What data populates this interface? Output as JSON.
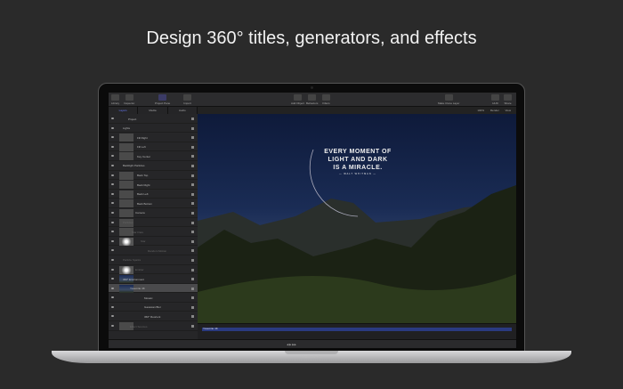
{
  "headline": "Design 360° titles, generators, and effects",
  "toolbar": {
    "library": "Library",
    "inspector": "Inspector",
    "project_pane": "Project Pane",
    "import": "Import",
    "add_object": "Add Object",
    "behaviors": "Behaviors",
    "filters": "Filters",
    "make_clone": "Make Clone Layer",
    "hud": "HUD",
    "share": "Share"
  },
  "tabs": [
    {
      "label": "Layers",
      "active": true
    },
    {
      "label": "Media"
    },
    {
      "label": "Audio"
    }
  ],
  "view_options": {
    "zoom": "100%",
    "render": "Render",
    "view": "View"
  },
  "layers": [
    {
      "name": "Project",
      "indent": 22,
      "thumb": false
    },
    {
      "name": "Lights",
      "indent": 16,
      "thumb": false
    },
    {
      "name": "Fill Right",
      "indent": 32,
      "thumb": true
    },
    {
      "name": "Fill Left",
      "indent": 32,
      "thumb": true
    },
    {
      "name": "Key Center",
      "indent": 32,
      "thumb": true
    },
    {
      "name": "Backlight Particles",
      "indent": 16,
      "thumb": false
    },
    {
      "name": "Back Top",
      "indent": 32,
      "thumb": true
    },
    {
      "name": "Back Right",
      "indent": 32,
      "thumb": true
    },
    {
      "name": "Back Left",
      "indent": 32,
      "thumb": true
    },
    {
      "name": "Back Bottom",
      "indent": 32,
      "thumb": true
    },
    {
      "name": "Camera",
      "indent": 30,
      "thumb": true
    },
    {
      "name": "Particles",
      "indent": 16,
      "thumb": true,
      "dim": true
    },
    {
      "name": "Star Flare",
      "indent": 26,
      "thumb": true,
      "dim": true
    },
    {
      "name": "Star",
      "indent": 36,
      "thumb": "glow",
      "dim": true
    },
    {
      "name": "Random Motion",
      "indent": 44,
      "thumb": false,
      "dim": true
    },
    {
      "name": "Particle Sparks",
      "indent": 16,
      "thumb": false,
      "dim": true
    },
    {
      "name": "Emitter",
      "indent": 30,
      "thumb": "glow",
      "dim": true
    },
    {
      "name": "360° Environment",
      "indent": 16,
      "thumb": "pic"
    },
    {
      "name": "Yosemite 4K",
      "indent": 24,
      "thumb": "pic",
      "selected": true
    },
    {
      "name": "Mosaic",
      "indent": 40,
      "thumb": false
    },
    {
      "name": "Gaussian Blur",
      "indent": 40,
      "thumb": false
    },
    {
      "name": "360° Reorient",
      "indent": 40,
      "thumb": false
    },
    {
      "name": "Effect Sources",
      "indent": 24,
      "thumb": true,
      "dim": true
    }
  ],
  "canvas": {
    "quote_lines": [
      "EVERY MOMENT OF",
      "LIGHT AND DARK",
      "IS A MIRACLE."
    ],
    "author": "— WALT WHITMAN —"
  },
  "timeline": {
    "clip": "Yosemite 4K"
  },
  "laptop_label": "MacBook Pro"
}
